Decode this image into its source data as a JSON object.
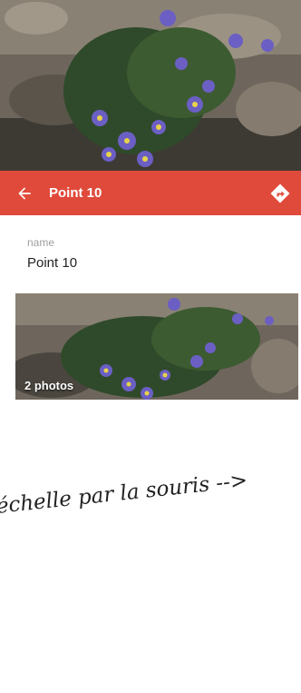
{
  "toolbar": {
    "title": "Point 10",
    "back_icon": "back-arrow-icon",
    "directions_icon": "directions-icon",
    "background": "#e04a3a"
  },
  "fields": {
    "name_label": "name",
    "name_value": "Point 10"
  },
  "gallery": {
    "count_label": "2 photos"
  },
  "overlay_note": "échelle par la souris -->"
}
